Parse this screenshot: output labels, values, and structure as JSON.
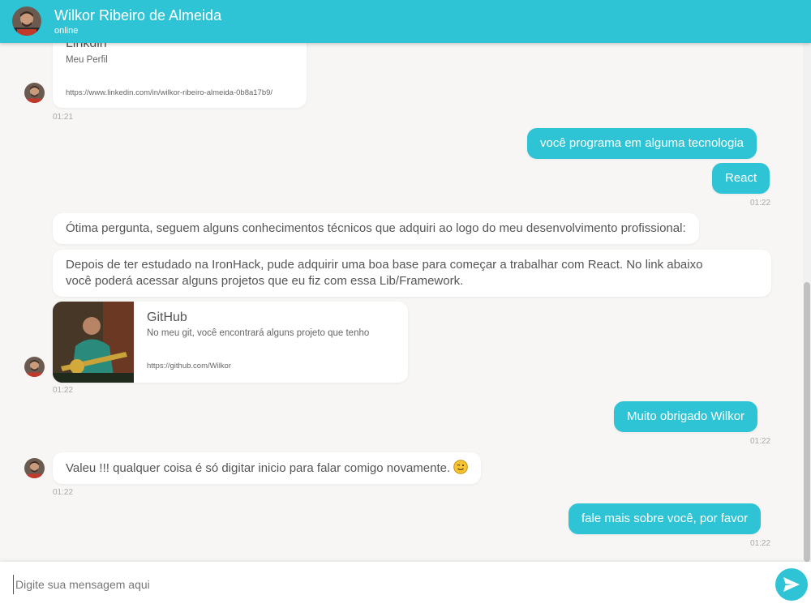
{
  "header": {
    "name": "Wilkor Ribeiro de Almeida",
    "status": "online"
  },
  "messages": {
    "linkedin_card": {
      "title": "Linkdin",
      "desc": "Meu Perfil",
      "url": "https://www.linkedin.com/in/wilkor-ribeiro-almeida-0b8a17b9/",
      "time": "01:21"
    },
    "q1": "você programa em alguma tecnologia",
    "q2": "React",
    "q_time": "01:22",
    "a1": "Ótima pergunta, seguem alguns conhecimentos técnicos que adquiri ao logo do meu desenvolvimento profissional:",
    "a2_line1": "Depois de ter estudado na IronHack, pude adquirir uma boa base para começar a trabalhar com React. No link abaixo",
    "a2_line2": "você poderá acessar alguns projetos que eu fiz com essa Lib/Framework.",
    "github_card": {
      "title": "GitHub",
      "desc": "No meu git, você encontrará alguns projeto que tenho",
      "url": "https://github.com/Wilkor",
      "time": "01:22"
    },
    "thanks": "Muito obrigado Wilkor",
    "thanks_time": "01:22",
    "reply": "Valeu !!! qualquer coisa é só digitar inicio para falar comigo novamente.",
    "reply_time": "01:22",
    "last": "fale mais sobre você, por favor",
    "last_time": "01:22"
  },
  "composer": {
    "placeholder": "Digite sua mensagem aqui"
  },
  "colors": {
    "accent": "#2ec4d6",
    "background": "#f7f6f4"
  }
}
